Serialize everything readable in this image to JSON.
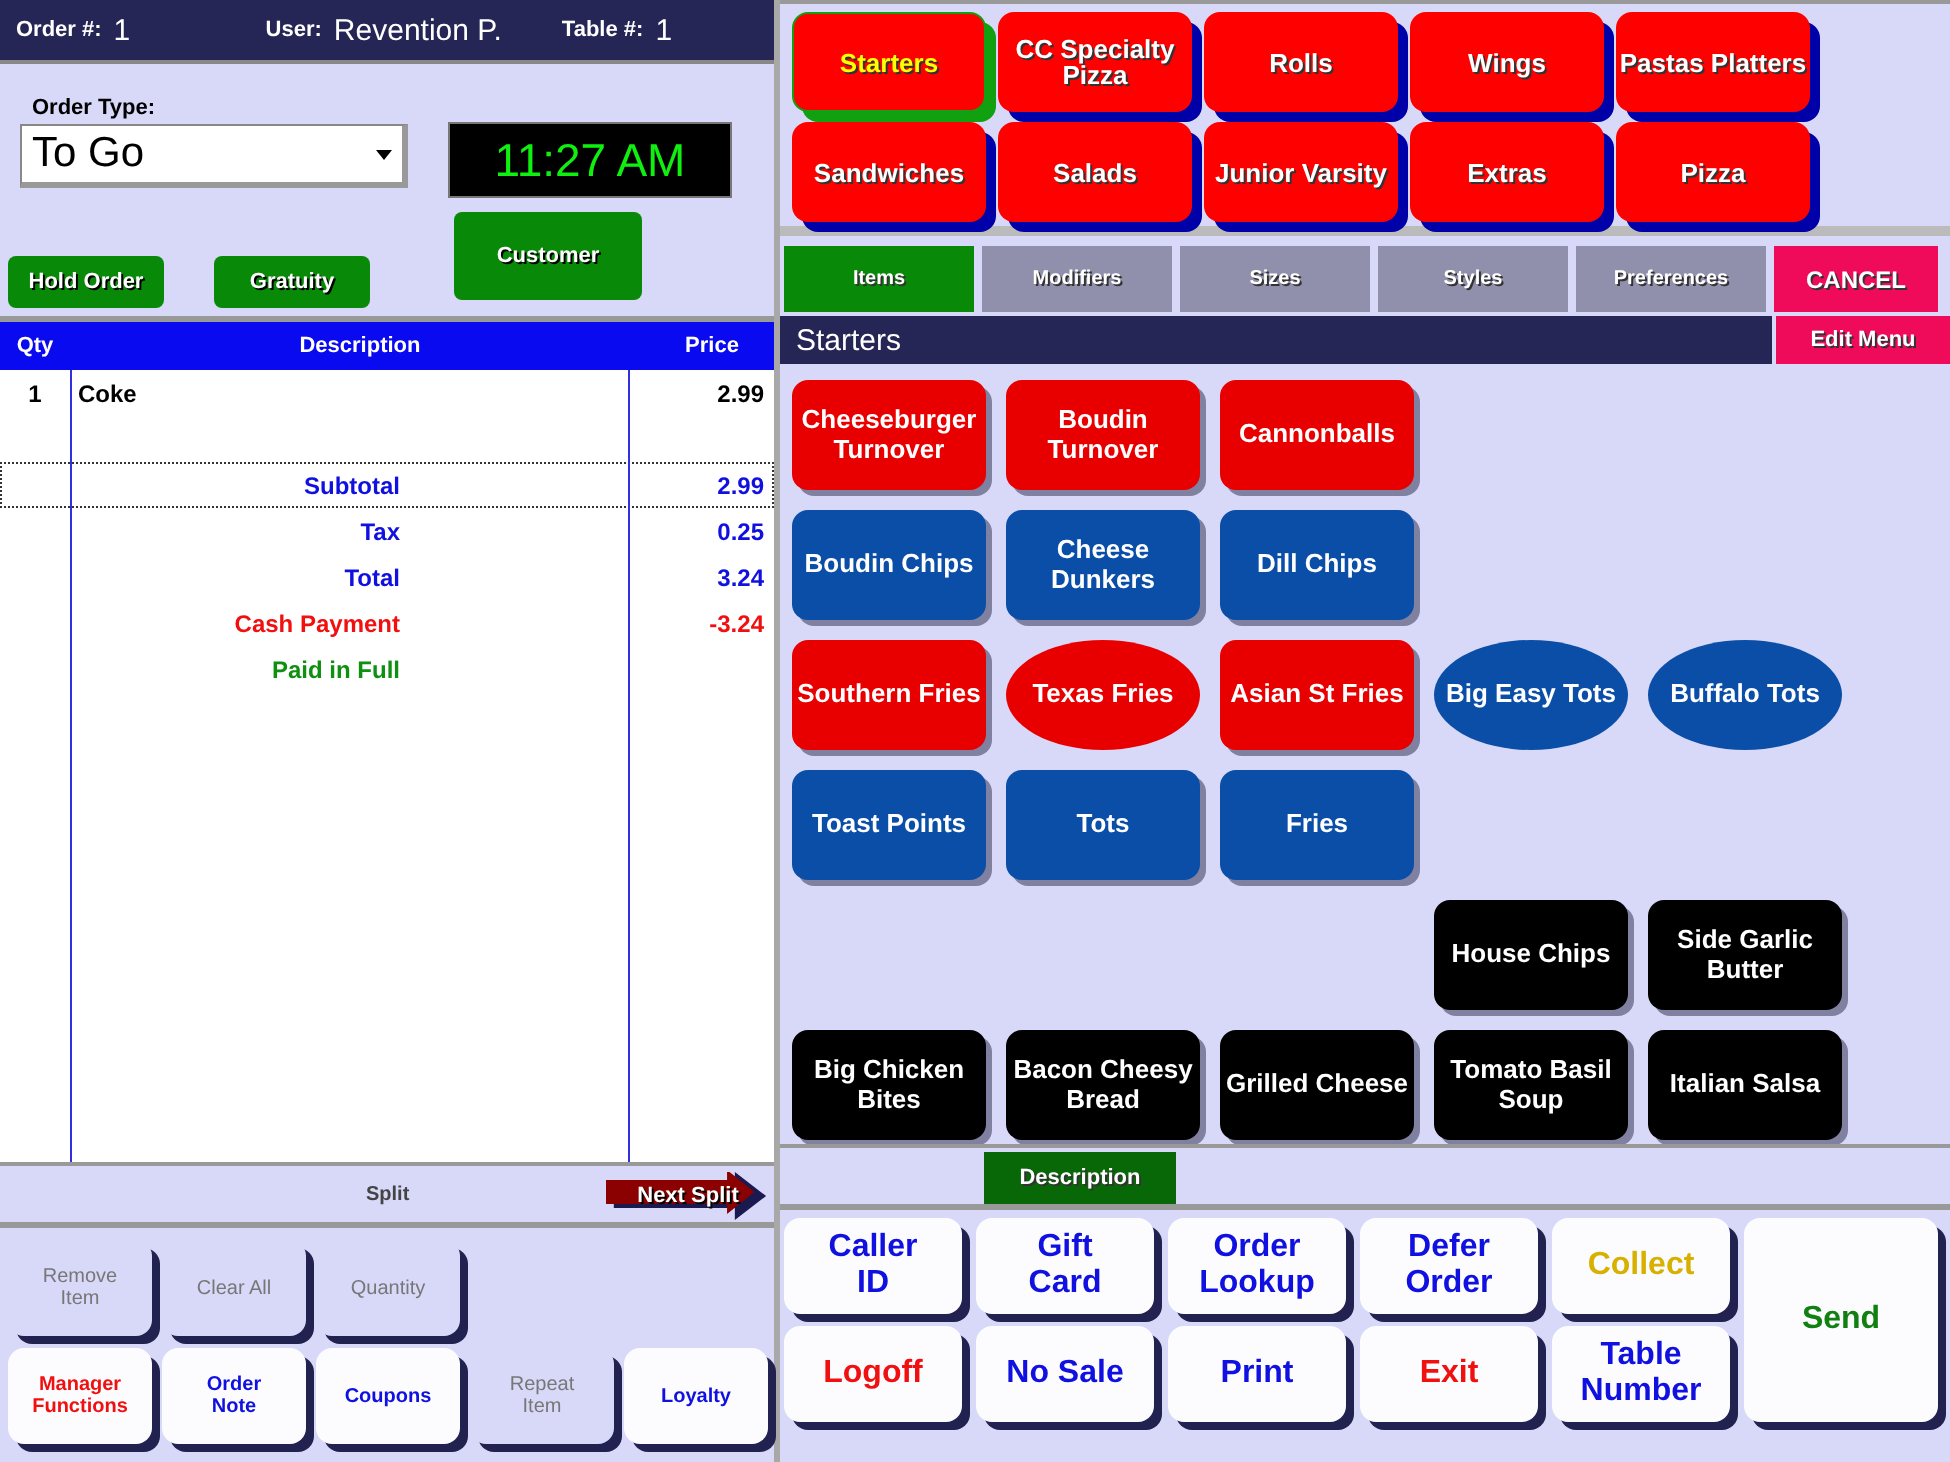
{
  "header": {
    "order_label": "Order #:",
    "order_number": "1",
    "user_label": "User:",
    "user": "Revention P.",
    "table_label": "Table #:",
    "table_number": "1"
  },
  "order_type": {
    "label": "Order Type:",
    "value": "To Go"
  },
  "clock": "11:27 AM",
  "order_buttons": [
    "Hold Order",
    "Gratuity",
    "Customer"
  ],
  "order_table": {
    "columns": [
      "Qty",
      "Description",
      "Price"
    ],
    "rows": [
      {
        "qty": "1",
        "description": "Coke",
        "price": "2.99"
      }
    ],
    "totals": [
      {
        "label": "Subtotal",
        "value": "2.99",
        "color": "#1010e0",
        "selected": true
      },
      {
        "label": "Tax",
        "value": "0.25",
        "color": "#1010e0",
        "selected": false
      },
      {
        "label": "Total",
        "value": "3.24",
        "color": "#1010e0",
        "selected": false
      },
      {
        "label": "Cash Payment",
        "value": "-3.24",
        "color": "#f01010",
        "selected": false
      },
      {
        "label": "Paid in Full",
        "color": "#109010",
        "selected": false
      }
    ]
  },
  "split_bar": {
    "label": "Split",
    "next": "Next Split"
  },
  "left_actions": [
    [
      {
        "label": "Remove Item",
        "disabled": true
      },
      {
        "label": "Clear All",
        "disabled": true
      },
      {
        "label": "Quantity",
        "disabled": true
      }
    ],
    [
      {
        "label": "Manager Functions",
        "disabled": false,
        "color": "#f01010"
      },
      {
        "label": "Order Note",
        "disabled": false,
        "color": "#1010e0"
      },
      {
        "label": "Coupons",
        "disabled": false,
        "color": "#1010e0"
      },
      {
        "label": "Repeat Item",
        "disabled": true
      },
      {
        "label": "Loyalty",
        "disabled": false,
        "color": "#1010e0"
      }
    ]
  ],
  "categories": [
    {
      "label": "Starters",
      "selected": true
    },
    {
      "label": "CC Specialty Pizza",
      "selected": false
    },
    {
      "label": "Rolls",
      "selected": false
    },
    {
      "label": "Wings",
      "selected": false
    },
    {
      "label": "Pastas Platters",
      "selected": false
    },
    {
      "label": "Sandwiches",
      "selected": false
    },
    {
      "label": "Salads",
      "selected": false
    },
    {
      "label": "Junior Varsity",
      "selected": false
    },
    {
      "label": "Extras",
      "selected": false
    },
    {
      "label": "Pizza",
      "selected": false
    }
  ],
  "tabs": [
    {
      "label": "Items",
      "selected": true,
      "kind": "tab"
    },
    {
      "label": "Modifiers",
      "selected": false,
      "kind": "tab"
    },
    {
      "label": "Sizes",
      "selected": false,
      "kind": "tab"
    },
    {
      "label": "Styles",
      "selected": false,
      "kind": "tab"
    },
    {
      "label": "Preferences",
      "selected": false,
      "kind": "tab"
    },
    {
      "label": "CANCEL",
      "kind": "action"
    }
  ],
  "menu_title": "Starters",
  "edit_menu": "Edit Menu",
  "menu_rows": [
    [
      {
        "label": "Cheeseburger Turnover",
        "kind": "rect",
        "color": "#e80000"
      },
      {
        "label": "Boudin Turnover",
        "kind": "rect",
        "color": "#e80000"
      },
      {
        "label": "Cannonballs",
        "kind": "rect",
        "color": "#e80000"
      }
    ],
    [
      {
        "label": "Boudin Chips",
        "kind": "rect",
        "color": "#0a4ea8"
      },
      {
        "label": "Cheese Dunkers",
        "kind": "rect",
        "color": "#0a4ea8"
      },
      {
        "label": "Dill Chips",
        "kind": "rect",
        "color": "#0a4ea8"
      }
    ],
    [
      {
        "label": "Southern Fries",
        "kind": "rect",
        "color": "#e80000"
      },
      {
        "label": "Texas Fries",
        "kind": "oval",
        "color": "#e80000"
      },
      {
        "label": "Asian St Fries",
        "kind": "rect",
        "color": "#e80000"
      },
      {
        "label": "Big Easy Tots",
        "kind": "oval",
        "color": "#0a4ea8"
      },
      {
        "label": "Buffalo Tots",
        "kind": "oval",
        "color": "#0a4ea8"
      }
    ],
    [
      {
        "label": "Toast Points",
        "kind": "rect",
        "color": "#0a4ea8"
      },
      {
        "label": "Tots",
        "kind": "rect",
        "color": "#0a4ea8"
      },
      {
        "label": "Fries",
        "kind": "rect",
        "color": "#0a4ea8"
      }
    ],
    [
      {
        "kind": "empty"
      },
      {
        "kind": "empty"
      },
      {
        "kind": "empty"
      },
      {
        "label": "House Chips",
        "kind": "rect",
        "color": "#000000"
      },
      {
        "label": "Side Garlic Butter",
        "kind": "rect",
        "color": "#000000"
      }
    ],
    [
      {
        "label": "Big Chicken Bites",
        "kind": "rect",
        "color": "#000000"
      },
      {
        "label": "Bacon Cheesy Bread",
        "kind": "rect",
        "color": "#000000"
      },
      {
        "label": "Grilled Cheese",
        "kind": "rect",
        "color": "#000000"
      },
      {
        "label": "Tomato Basil Soup",
        "kind": "rect",
        "color": "#000000"
      },
      {
        "label": "Italian Salsa",
        "kind": "rect",
        "color": "#000000"
      }
    ]
  ],
  "sort_bar": {
    "label": "Description"
  },
  "right_actions": [
    {
      "label": "Caller ID",
      "color": "#1010e0"
    },
    {
      "label": "Gift Card",
      "color": "#1010e0"
    },
    {
      "label": "Order Lookup",
      "color": "#1010e0"
    },
    {
      "label": "Defer Order",
      "color": "#1010e0"
    },
    {
      "label": "Collect",
      "color": "#d8b000"
    },
    {
      "label": "Logoff",
      "color": "#f01010"
    },
    {
      "label": "No Sale",
      "color": "#1010e0"
    },
    {
      "label": "Print",
      "color": "#1010e0"
    },
    {
      "label": "Exit",
      "color": "#f01010"
    },
    {
      "label": "Table Number",
      "color": "#1010e0"
    }
  ],
  "send": {
    "label": "Send",
    "color": "#108010"
  }
}
